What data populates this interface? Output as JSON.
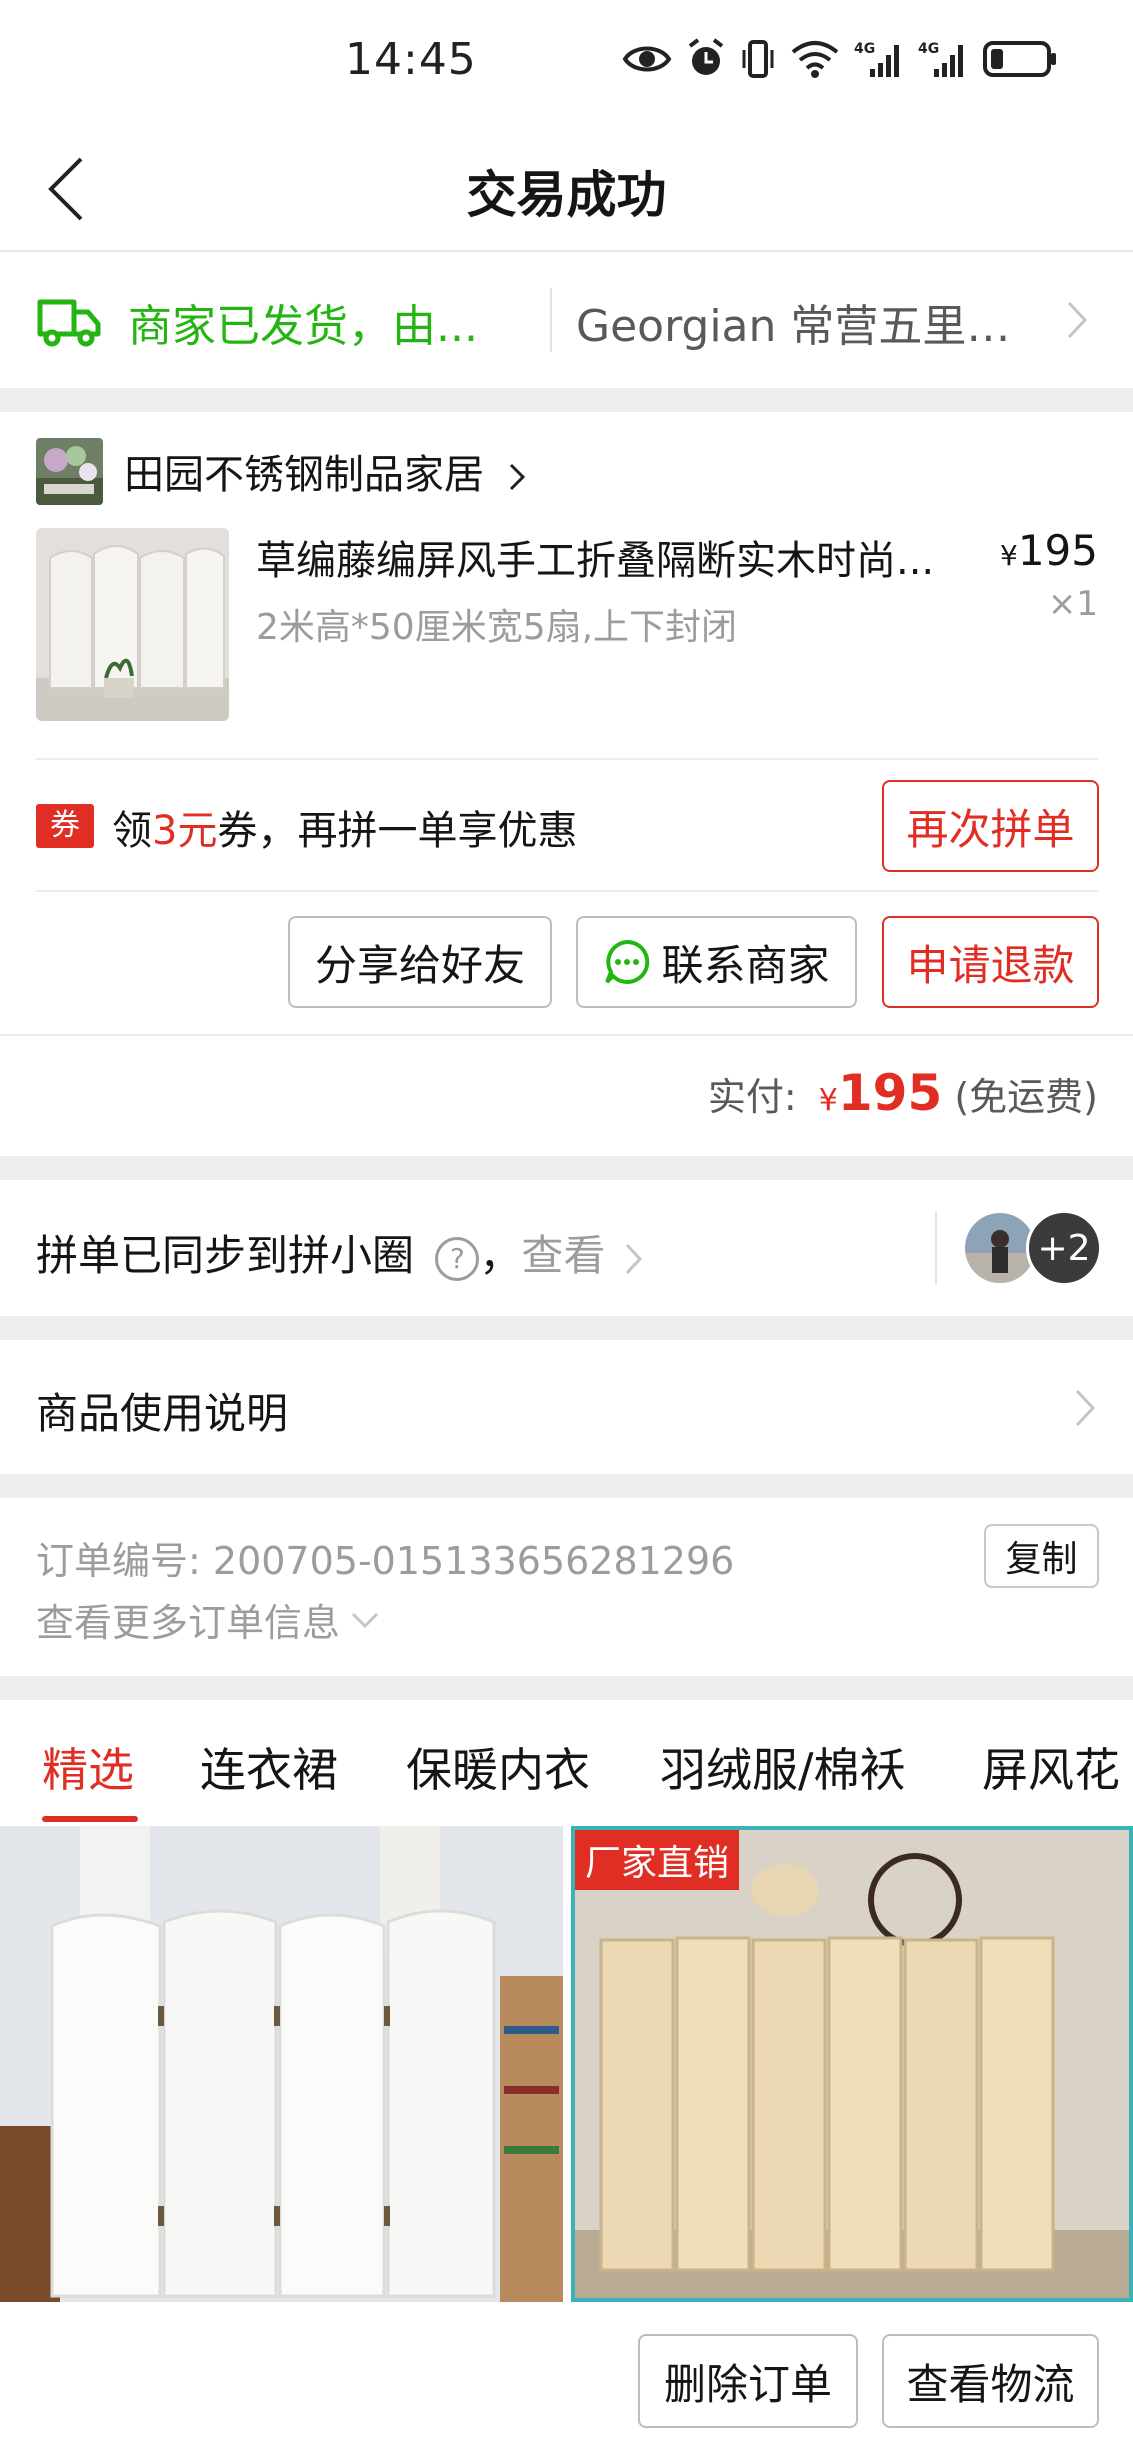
{
  "status_bar": {
    "time": "14:45",
    "icons": [
      "eye-icon",
      "alarm-icon",
      "vibrate-icon",
      "wifi-icon",
      "signal-4g-icon",
      "signal-4g-icon",
      "battery-icon"
    ]
  },
  "nav": {
    "title": "交易成功"
  },
  "logistics": {
    "status": "商家已发货，由...",
    "address": "Georgian 常营五里桥..."
  },
  "order": {
    "store_name": "田园不锈钢制品家居",
    "product_title": "草编藤编屏风手工折叠隔断实木时尚...",
    "product_spec": "2米高*50厘米宽5扇,上下封闭",
    "price_symbol": "¥",
    "price": "195",
    "quantity": "×1",
    "coupon": {
      "badge": "券",
      "prefix": "领",
      "amount": "3元",
      "suffix": "券，再拼一单享优惠",
      "button": "再次拼单"
    },
    "actions": {
      "share": "分享给好友",
      "contact": "联系商家",
      "refund": "申请退款"
    },
    "paid": {
      "label": "实付:",
      "symbol": "¥",
      "amount": "195",
      "note": "(免运费)"
    }
  },
  "circle": {
    "text": "拼单已同步到拼小圈",
    "help": "?",
    "view_prefix": "，",
    "view": "查看",
    "more_count": "+2"
  },
  "manual": {
    "label": "商品使用说明"
  },
  "order_info": {
    "number_label": "订单编号:",
    "number": "200705-015133656281296",
    "more": "查看更多订单信息",
    "copy": "复制"
  },
  "tabs": [
    "精选",
    "连衣裙",
    "保暖内衣",
    "羽绒服/棉袄",
    "屏风花"
  ],
  "recommend": {
    "promo_tag": "厂家直销"
  },
  "bottom_bar": {
    "delete": "删除订单",
    "logistics": "查看物流"
  },
  "colors": {
    "accent": "#e02e24",
    "green": "#25b513",
    "grey_text": "#9c9c9c"
  }
}
